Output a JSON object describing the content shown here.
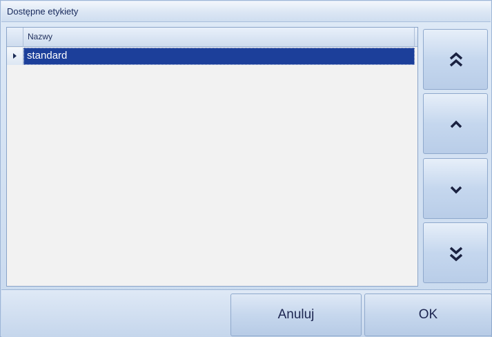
{
  "window": {
    "title": "Dostępne etykiety"
  },
  "list": {
    "column_header": "Nazwy",
    "rows": [
      {
        "name": "standard",
        "selected": true
      }
    ]
  },
  "nav_buttons": {
    "top_icon": "double-chevron-up-icon",
    "up_icon": "chevron-up-icon",
    "down_icon": "chevron-down-icon",
    "bottom_icon": "double-chevron-down-icon"
  },
  "footer": {
    "cancel_label": "Anuluj",
    "ok_label": "OK"
  },
  "colors": {
    "selection": "#1c3f9a",
    "accent": "#c5d7ee"
  }
}
